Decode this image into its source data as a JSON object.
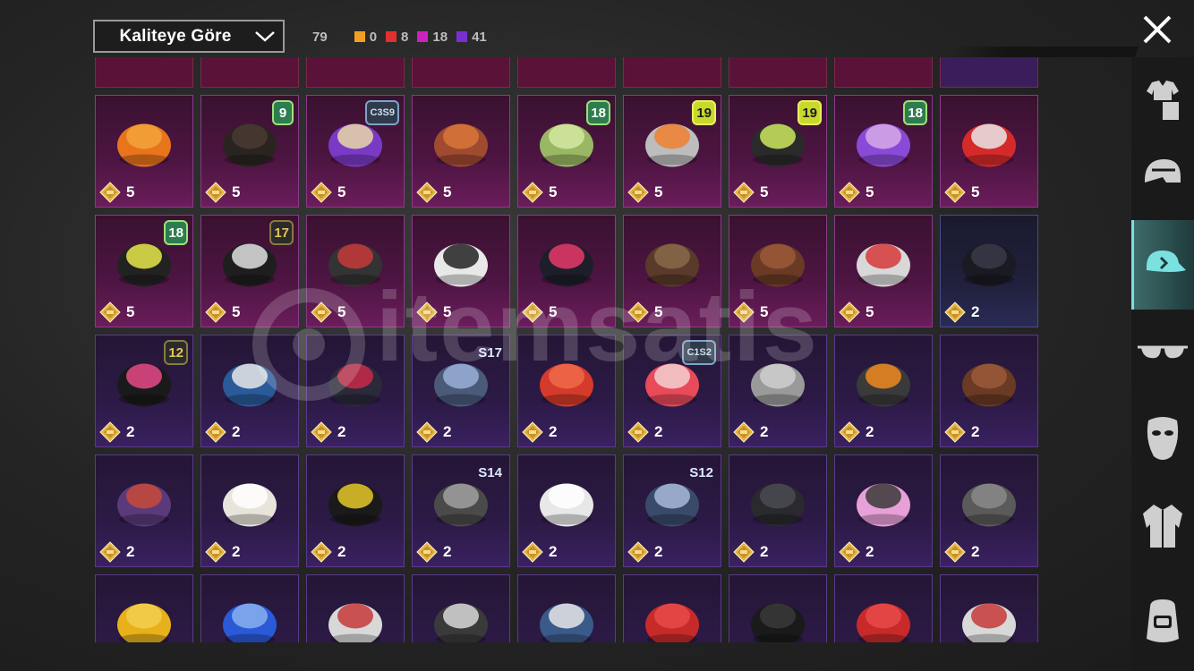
{
  "sort": {
    "label": "Kaliteye Göre"
  },
  "counts": {
    "total": "79",
    "legendary": {
      "value": "0",
      "color": "#f0a020"
    },
    "red": {
      "value": "8",
      "color": "#e03030"
    },
    "pink": {
      "value": "18",
      "color": "#d020c0"
    },
    "purple": {
      "value": "41",
      "color": "#7a30d0"
    }
  },
  "watermark": "itemsatis",
  "items": [
    {
      "price": "5",
      "style": "pink",
      "badge": "",
      "badge_type": "",
      "icon": "pumpkin-hat-icon"
    },
    {
      "price": "5",
      "style": "pink",
      "badge": "9",
      "badge_type": "green",
      "icon": "long-hair-icon"
    },
    {
      "price": "5",
      "style": "pink",
      "badge": "C3S9",
      "badge_type": "slate",
      "icon": "purple-cap-hair-icon"
    },
    {
      "price": "5",
      "style": "pink",
      "badge": "",
      "badge_type": "",
      "icon": "red-headband-hair-icon"
    },
    {
      "price": "5",
      "style": "pink",
      "badge": "18",
      "badge_type": "green",
      "icon": "tentacle-hat-icon"
    },
    {
      "price": "5",
      "style": "pink",
      "badge": "19",
      "badge_type": "yellow",
      "icon": "cat-ears-headphones-icon"
    },
    {
      "price": "5",
      "style": "pink",
      "badge": "19",
      "badge_type": "yellow",
      "icon": "bug-helmet-icon"
    },
    {
      "price": "5",
      "style": "pink",
      "badge": "18",
      "badge_type": "green",
      "icon": "purple-helmet-icon"
    },
    {
      "price": "5",
      "style": "pink",
      "badge": "",
      "badge_type": "",
      "icon": "santa-beard-hat-icon"
    },
    {
      "price": "5",
      "style": "pink",
      "badge": "18",
      "badge_type": "green",
      "icon": "cap-headphones-icon"
    },
    {
      "price": "5",
      "style": "pink",
      "badge": "17",
      "badge_type": "dark",
      "icon": "mask-helmet-icon"
    },
    {
      "price": "5",
      "style": "pink",
      "badge": "",
      "badge_type": "",
      "icon": "feather-hat-icon"
    },
    {
      "price": "5",
      "style": "pink",
      "badge": "",
      "badge_type": "",
      "icon": "zebra-mask-icon"
    },
    {
      "price": "5",
      "style": "pink",
      "badge": "",
      "badge_type": "",
      "icon": "cap-red-hair-icon"
    },
    {
      "price": "5",
      "style": "pink",
      "badge": "",
      "badge_type": "",
      "icon": "antlers-headband-icon"
    },
    {
      "price": "5",
      "style": "pink",
      "badge": "",
      "badge_type": "",
      "icon": "bear-mask-icon"
    },
    {
      "price": "5",
      "style": "pink",
      "badge": "",
      "badge_type": "",
      "icon": "chicken-hood-icon"
    },
    {
      "price": "2",
      "style": "blue",
      "badge": "",
      "badge_type": "",
      "icon": "black-hair-icon"
    },
    {
      "price": "2",
      "style": "purple",
      "badge": "12",
      "badge_type": "dark",
      "icon": "bunny-ears-helmet-icon"
    },
    {
      "price": "2",
      "style": "purple",
      "badge": "",
      "badge_type": "",
      "icon": "baseball-cap-icon"
    },
    {
      "price": "2",
      "style": "purple",
      "badge": "",
      "badge_type": "",
      "icon": "bucket-hat-hair-icon"
    },
    {
      "price": "2",
      "style": "purple",
      "badge": "S17",
      "badge_type": "season",
      "icon": "horned-helmet-icon"
    },
    {
      "price": "2",
      "style": "purple",
      "badge": "",
      "badge_type": "",
      "icon": "fez-hat-icon"
    },
    {
      "price": "2",
      "style": "purple",
      "badge": "C1S2",
      "badge_type": "slate",
      "icon": "striped-beanie-icon"
    },
    {
      "price": "2",
      "style": "purple",
      "badge": "",
      "badge_type": "",
      "icon": "grey-hair-icon"
    },
    {
      "price": "2",
      "style": "purple",
      "badge": "",
      "badge_type": "",
      "icon": "orange-visor-helmet-icon"
    },
    {
      "price": "2",
      "style": "purple",
      "badge": "",
      "badge_type": "",
      "icon": "brown-hair-icon"
    },
    {
      "price": "2",
      "style": "purple",
      "badge": "",
      "badge_type": "",
      "icon": "witch-hat-icon"
    },
    {
      "price": "2",
      "style": "purple",
      "badge": "",
      "badge_type": "",
      "icon": "white-beanie-icon"
    },
    {
      "price": "2",
      "style": "purple",
      "badge": "",
      "badge_type": "",
      "icon": "fedora-icon"
    },
    {
      "price": "2",
      "style": "purple",
      "badge": "S14",
      "badge_type": "season",
      "icon": "gladiator-helmet-icon"
    },
    {
      "price": "2",
      "style": "purple",
      "badge": "",
      "badge_type": "",
      "icon": "white-cap-icon"
    },
    {
      "price": "2",
      "style": "purple",
      "badge": "S12",
      "badge_type": "season",
      "icon": "space-helmet-icon"
    },
    {
      "price": "2",
      "style": "purple",
      "badge": "",
      "badge_type": "",
      "icon": "black-cap-icon"
    },
    {
      "price": "2",
      "style": "purple",
      "badge": "",
      "badge_type": "",
      "icon": "pink-cat-headphones-icon"
    },
    {
      "price": "2",
      "style": "purple",
      "badge": "",
      "badge_type": "",
      "icon": "grey-helmet-icon"
    },
    {
      "price": "",
      "style": "purple",
      "badge": "",
      "badge_type": "",
      "icon": "yellow-bucket-hat-icon"
    },
    {
      "price": "",
      "style": "purple",
      "badge": "",
      "badge_type": "",
      "icon": "blue-bucket-icon"
    },
    {
      "price": "",
      "style": "purple",
      "badge": "",
      "badge_type": "",
      "icon": "bucket-icon"
    },
    {
      "price": "",
      "style": "purple",
      "badge": "",
      "badge_type": "",
      "icon": "wrestler-mask-icon"
    },
    {
      "price": "",
      "style": "purple",
      "badge": "",
      "badge_type": "",
      "icon": "shark-hat-icon"
    },
    {
      "price": "",
      "style": "purple",
      "badge": "",
      "badge_type": "",
      "icon": "red-beret-icon"
    },
    {
      "price": "",
      "style": "purple",
      "badge": "",
      "badge_type": "",
      "icon": "black-top-hat-icon"
    },
    {
      "price": "",
      "style": "purple",
      "badge": "",
      "badge_type": "",
      "icon": "red-fedora-icon"
    },
    {
      "price": "",
      "style": "purple",
      "badge": "",
      "badge_type": "",
      "icon": "white-shark-hat-icon"
    }
  ],
  "sidebar": [
    {
      "icon": "outfit-icon",
      "active": false
    },
    {
      "icon": "helmet-icon",
      "active": false
    },
    {
      "icon": "hat-icon",
      "active": true
    },
    {
      "icon": "glasses-icon",
      "active": false
    },
    {
      "icon": "face-mask-icon",
      "active": false
    },
    {
      "icon": "jacket-icon",
      "active": false
    },
    {
      "icon": "backpack-icon",
      "active": false
    }
  ]
}
